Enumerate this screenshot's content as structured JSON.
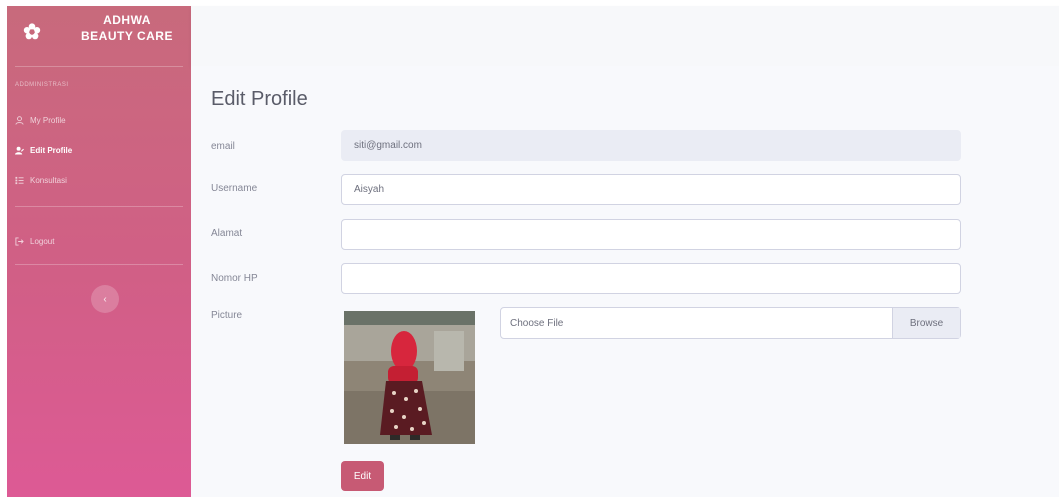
{
  "sidebar": {
    "brand_line1": "ADHWA",
    "brand_line2": "BEAUTY CARE",
    "heading": "Addministrasi",
    "items": [
      {
        "label": "My Profile",
        "icon": "user-icon"
      },
      {
        "label": "Edit Profile",
        "icon": "user-edit-icon"
      },
      {
        "label": "Konsultasi",
        "icon": "list-icon"
      }
    ],
    "logout": {
      "label": "Logout",
      "icon": "sign-out-icon"
    },
    "toggle_icon": "chevron-left-icon"
  },
  "page": {
    "title": "Edit Profile"
  },
  "form": {
    "email": {
      "label": "email",
      "value": "siti@gmail.com"
    },
    "username": {
      "label": "Username",
      "value": "Aisyah"
    },
    "alamat": {
      "label": "Alamat",
      "value": ""
    },
    "nomor_hp": {
      "label": "Nomor HP",
      "value": ""
    },
    "picture": {
      "label": "Picture",
      "file_placeholder": "Choose File",
      "browse_label": "Browse"
    },
    "submit_label": "Edit"
  },
  "colors": {
    "sidebar_gradient_top": "#c86a7c",
    "sidebar_gradient_bottom": "#dd5a95",
    "edit_button": "#c75a74"
  }
}
